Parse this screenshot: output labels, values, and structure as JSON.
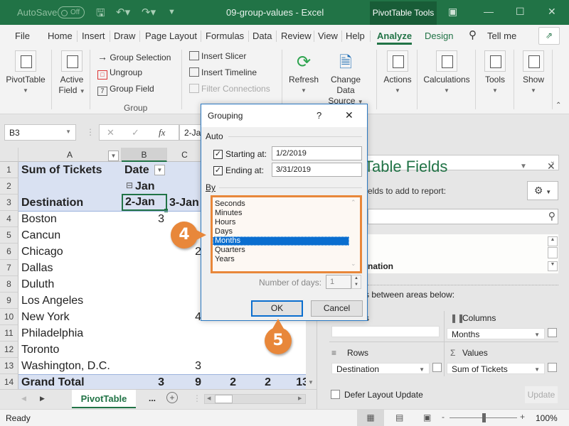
{
  "titlebar": {
    "autosave_label": "AutoSave",
    "autosave_state": "Off",
    "doc_title": "09-group-values  -  Excel",
    "context_tab": "PivotTable Tools"
  },
  "tabs": [
    "File",
    "Home",
    "Insert",
    "Draw",
    "Page Layout",
    "Formulas",
    "Data",
    "Review",
    "View",
    "Help",
    "Analyze",
    "Design"
  ],
  "active_tab": "Analyze",
  "tell_me": "Tell me",
  "ribbon": {
    "pivottable": "PivotTable",
    "active_field_1": "Active",
    "active_field_2": "Field",
    "group_selection": "Group Selection",
    "ungroup": "Ungroup",
    "group_field": "Group Field",
    "group_label": "Group",
    "insert_slicer": "Insert Slicer",
    "insert_timeline": "Insert Timeline",
    "filter_connections": "Filter Connections",
    "refresh": "Refresh",
    "change_data_1": "Change Data",
    "change_data_2": "Source",
    "actions": "Actions",
    "calculations": "Calculations",
    "tools": "Tools",
    "show": "Show"
  },
  "formula_bar": {
    "name_box": "B3",
    "fx": "fx",
    "value": "2-Jan"
  },
  "grid": {
    "columns": [
      "A",
      "B",
      "C"
    ],
    "rows": [
      {
        "n": "1",
        "a": "Sum of Tickets",
        "b": "Date",
        "c": ""
      },
      {
        "n": "2",
        "a": "",
        "b": "Jan",
        "c": ""
      },
      {
        "n": "3",
        "a": "Destination",
        "b": "2-Jan",
        "c": "3-Jan"
      },
      {
        "n": "4",
        "a": "Boston",
        "b": "3",
        "c": ""
      },
      {
        "n": "5",
        "a": "Cancun",
        "b": "",
        "c": ""
      },
      {
        "n": "6",
        "a": "Chicago",
        "b": "",
        "c": "2"
      },
      {
        "n": "7",
        "a": "Dallas",
        "b": "",
        "c": ""
      },
      {
        "n": "8",
        "a": "Duluth",
        "b": "",
        "c": ""
      },
      {
        "n": "9",
        "a": "Los Angeles",
        "b": "",
        "c": ""
      },
      {
        "n": "10",
        "a": "New York",
        "b": "",
        "c": "4"
      },
      {
        "n": "11",
        "a": "Philadelphia",
        "b": "",
        "c": ""
      },
      {
        "n": "12",
        "a": "Toronto",
        "b": "",
        "c": ""
      },
      {
        "n": "13",
        "a": "Washington, D.C.",
        "b": "",
        "c": "3"
      },
      {
        "n": "14",
        "a": "Grand Total",
        "b": "3",
        "c": "9"
      }
    ],
    "grand_total_extra": [
      "2",
      "2",
      "13"
    ]
  },
  "sheet_tabs": {
    "active": "PivotTable",
    "more": "...",
    "add": "+"
  },
  "status": {
    "ready": "Ready",
    "zoom": "100%"
  },
  "dialog": {
    "title": "Grouping",
    "help": "?",
    "auto_label": "Auto",
    "starting_label": "Starting at:",
    "starting_value": "1/2/2019",
    "starting_checked": true,
    "ending_label": "Ending at:",
    "ending_value": "3/31/2019",
    "ending_checked": true,
    "by_label": "By",
    "by_options": [
      "Seconds",
      "Minutes",
      "Hours",
      "Days",
      "Months",
      "Quarters",
      "Years"
    ],
    "by_selected": "Months",
    "num_days_label": "Number of days:",
    "num_days_value": "1",
    "ok": "OK",
    "cancel": "Cancel"
  },
  "pane": {
    "title": "Table Fields",
    "choose_label": "elds to add to report:",
    "field_partial": "nation",
    "drag_label": "s between areas below:",
    "filters_partial": "s",
    "columns_label": "Columns",
    "columns_value": "Months",
    "rows_label": "Rows",
    "rows_value": "Destination",
    "values_label": "Values",
    "values_value": "Sum of Tickets",
    "defer_label": "Defer Layout Update",
    "update": "Update"
  },
  "callouts": [
    "4",
    "5"
  ],
  "colors": {
    "excel_green": "#217346",
    "callout_orange": "#e8873a",
    "selection_blue": "#0a6ecf",
    "pivot_header": "#d9e1f2"
  }
}
